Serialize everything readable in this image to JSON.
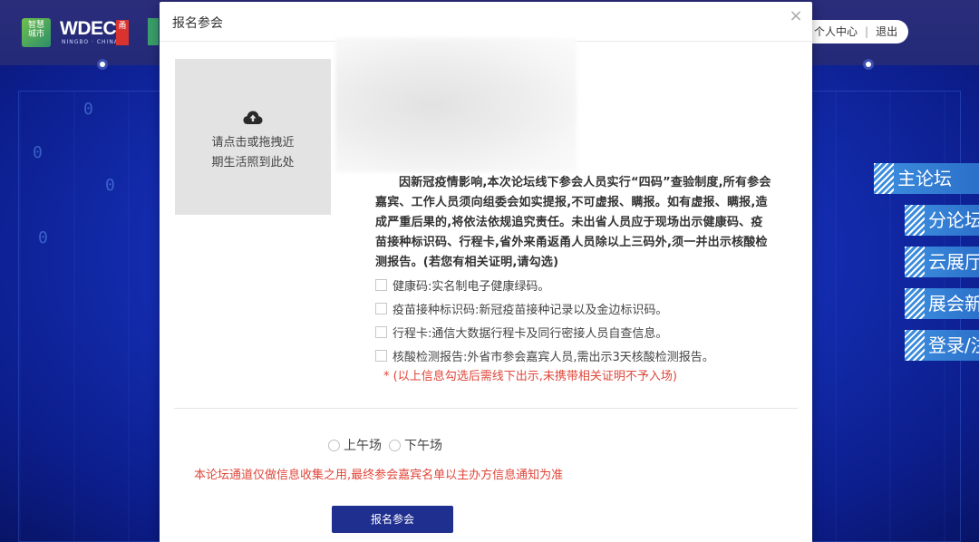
{
  "background": {
    "logo": {
      "brand": "WDEC",
      "sub": "NINGBO · CHINA"
    },
    "user_menu": {
      "user_center": "个人中心",
      "separator": "|",
      "logout": "退出"
    },
    "right_nav": [
      {
        "label": "主论坛"
      },
      {
        "label": "分论坛"
      },
      {
        "label": "云展厅"
      },
      {
        "label": "展会新"
      },
      {
        "label": "登录/注"
      }
    ],
    "digits": [
      "0",
      "0",
      "0",
      "0"
    ]
  },
  "modal": {
    "title": "报名参会",
    "close_icon": "×",
    "upload": {
      "icon": "cloud-upload-icon",
      "line1": "请点击或拖拽近",
      "line2": "期生活照到此处"
    },
    "notice": "因新冠疫情影响,本次论坛线下参会人员实行“四码”查验制度,所有参会嘉宾、工作人员须向组委会如实提报,不可虚报、瞒报。如有虚报、瞒报,造成严重后果的,将依法依规追究责任。未出省人员应于现场出示健康码、疫苗接种标识码、行程卡,省外来甬返甬人员除以上三码外,须一并出示核酸检测报告。(若您有相关证明,请勾选)",
    "checklist": [
      {
        "label": "健康码:实名制电子健康绿码。",
        "checked": false
      },
      {
        "label": "疫苗接种标识码:新冠疫苗接种记录以及金边标识码。",
        "checked": false
      },
      {
        "label": "行程卡:通信大数据行程卡及同行密接人员自查信息。",
        "checked": false
      },
      {
        "label": "核酸检测报告:外省市参会嘉宾人员,需出示3天核酸检测报告。",
        "checked": false
      }
    ],
    "check_warning": "* (以上信息勾选后需线下出示,未携带相关证明不予入场)",
    "sessions": [
      {
        "label": "上午场",
        "selected": false
      },
      {
        "label": "下午场",
        "selected": false
      }
    ],
    "forum_note": "本论坛通道仅做信息收集之用,最终参会嘉宾名单以主办方信息通知为准",
    "submit_label": "报名参会"
  },
  "colors": {
    "primary_button": "#1f2f8f",
    "warning_text": "#e0463a",
    "background_blue": "#1530b8"
  }
}
